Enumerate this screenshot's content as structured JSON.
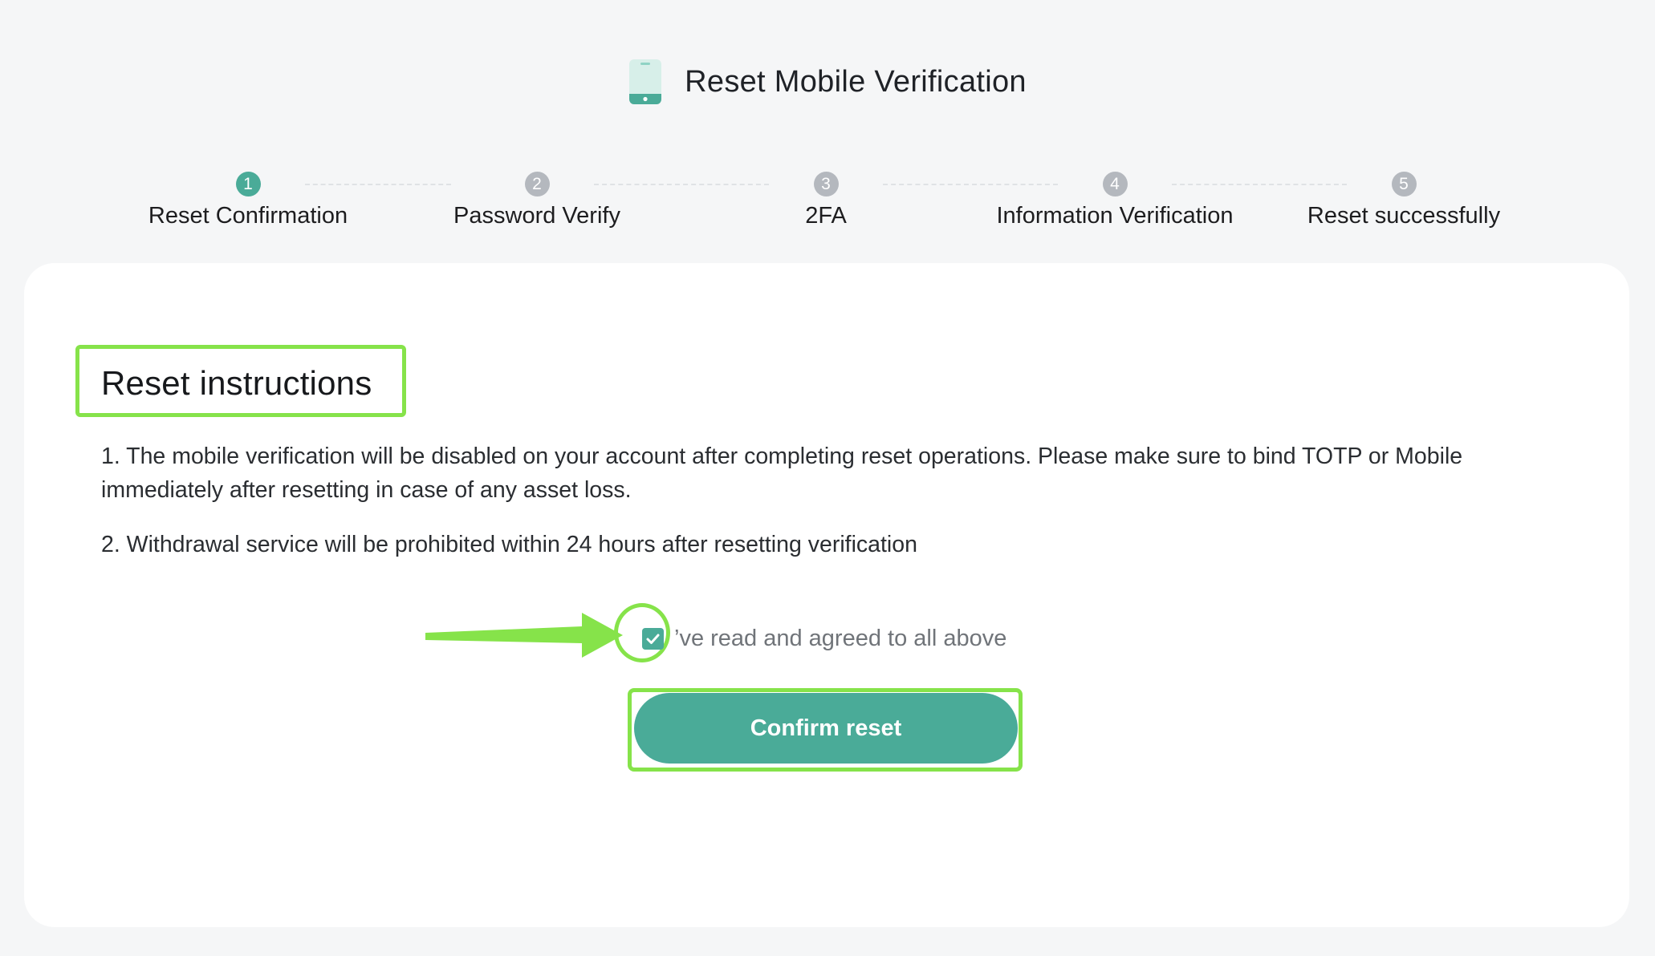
{
  "header": {
    "icon": "mobile-phone-icon",
    "title": "Reset Mobile Verification"
  },
  "steps": [
    {
      "number": "1",
      "label": "Reset Confirmation",
      "active": true
    },
    {
      "number": "2",
      "label": "Password Verify",
      "active": false
    },
    {
      "number": "3",
      "label": "2FA",
      "active": false
    },
    {
      "number": "4",
      "label": "Information Verification",
      "active": false
    },
    {
      "number": "5",
      "label": "Reset successfully",
      "active": false
    }
  ],
  "instructions": {
    "title": "Reset instructions",
    "items": [
      "1. The mobile verification will be disabled on your account after completing reset operations. Please make sure to bind TOTP or Mobile immediately after resetting in case of any asset loss.",
      "2. Withdrawal service will be prohibited within 24 hours after resetting verification"
    ]
  },
  "agreement": {
    "checked": true,
    "label": "’ve read and agreed to all above"
  },
  "confirm_button": {
    "label": "Confirm reset"
  },
  "colors": {
    "accent": "#4aab98",
    "highlight": "#86e34a",
    "inactive_step": "#b4b8be",
    "background": "#f5f6f7"
  }
}
